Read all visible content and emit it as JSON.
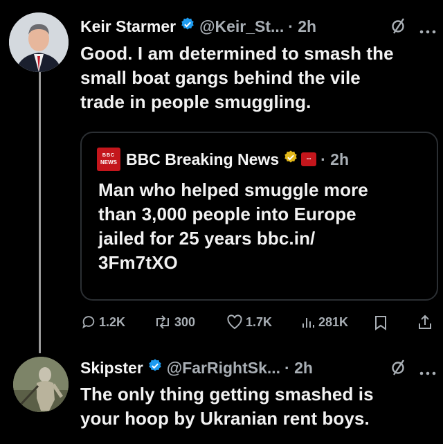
{
  "tweet": {
    "author": "Keir Starmer",
    "handle": "@Keir_St...",
    "time": "· 2h",
    "text_lines": [
      "Good. I am determined to smash the",
      "small boat gangs behind the vile",
      "trade in people smuggling."
    ],
    "quote": {
      "author": "BBC Breaking News",
      "time": "· 2h",
      "logo_text": [
        "BBC",
        "NEWS"
      ],
      "text_lines": [
        "Man who helped smuggle more",
        "than 3,000 people into Europe",
        "jailed for 25 years bbc.in/",
        "3Fm7tXO"
      ]
    },
    "metrics": {
      "replies": "1.2K",
      "reposts": "300",
      "likes": "1.7K",
      "views": "281K"
    }
  },
  "reply": {
    "author": "Skipster",
    "handle": "@FarRightSk...",
    "time": "· 2h",
    "text_lines": [
      "The only thing getting smashed is",
      "your hoop by Ukranian rent boys."
    ]
  },
  "colors": {
    "verified": "#1d9bf0",
    "verified_org": "#e2b719",
    "bbc_red": "#c4161c"
  }
}
